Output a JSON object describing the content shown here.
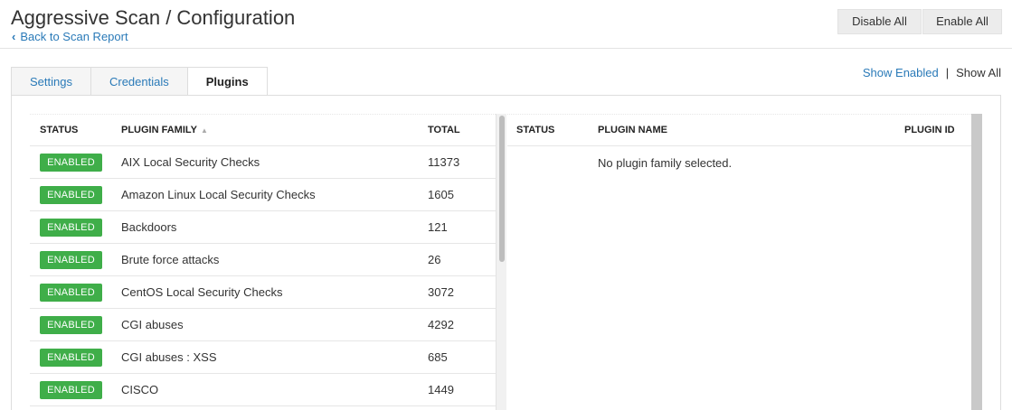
{
  "header": {
    "title": "Aggressive Scan / Configuration",
    "back_label": "Back to Scan Report",
    "disable_all_label": "Disable All",
    "enable_all_label": "Enable All"
  },
  "tabs": [
    {
      "label": "Settings",
      "active": false
    },
    {
      "label": "Credentials",
      "active": false
    },
    {
      "label": "Plugins",
      "active": true
    }
  ],
  "view_filter": {
    "show_enabled_label": "Show Enabled",
    "separator": "|",
    "show_all_label": "Show All"
  },
  "families_table": {
    "columns": {
      "status": "STATUS",
      "family": "PLUGIN FAMILY",
      "total": "TOTAL"
    },
    "rows": [
      {
        "status": "ENABLED",
        "family": "AIX Local Security Checks",
        "total": "11373"
      },
      {
        "status": "ENABLED",
        "family": "Amazon Linux Local Security Checks",
        "total": "1605"
      },
      {
        "status": "ENABLED",
        "family": "Backdoors",
        "total": "121"
      },
      {
        "status": "ENABLED",
        "family": "Brute force attacks",
        "total": "26"
      },
      {
        "status": "ENABLED",
        "family": "CentOS Local Security Checks",
        "total": "3072"
      },
      {
        "status": "ENABLED",
        "family": "CGI abuses",
        "total": "4292"
      },
      {
        "status": "ENABLED",
        "family": "CGI abuses : XSS",
        "total": "685"
      },
      {
        "status": "ENABLED",
        "family": "CISCO",
        "total": "1449"
      }
    ]
  },
  "plugins_table": {
    "columns": {
      "status": "STATUS",
      "name": "PLUGIN NAME",
      "id": "PLUGIN ID"
    },
    "empty_message": "No plugin family selected."
  },
  "colors": {
    "link": "#2a7ab8",
    "enabled_badge": "#3fae49"
  }
}
